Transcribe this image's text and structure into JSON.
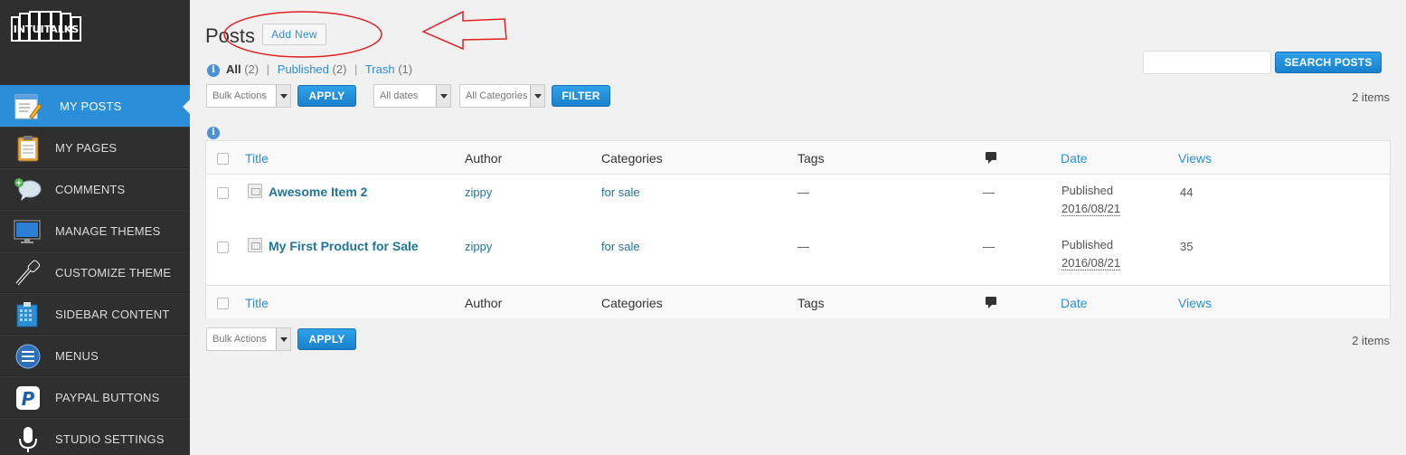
{
  "sidebar": {
    "logo_text": "INTUITALKS",
    "items": [
      {
        "label": "MY POSTS",
        "icon": "posts-icon",
        "active": true
      },
      {
        "label": "MY PAGES",
        "icon": "pages-icon"
      },
      {
        "label": "COMMENTS",
        "icon": "comments-icon"
      },
      {
        "label": "MANAGE THEMES",
        "icon": "monitor-icon"
      },
      {
        "label": "CUSTOMIZE THEME",
        "icon": "eyedropper-icon"
      },
      {
        "label": "SIDEBAR CONTENT",
        "icon": "sidebar-icon"
      },
      {
        "label": "MENUS",
        "icon": "menu-icon"
      },
      {
        "label": "PAYPAL BUTTONS",
        "icon": "paypal-icon"
      },
      {
        "label": "STUDIO SETTINGS",
        "icon": "microphone-icon"
      }
    ]
  },
  "header": {
    "title": "Posts",
    "add_new": "Add New"
  },
  "filters": {
    "all_label": "All",
    "all_count": "(2)",
    "published_label": "Published",
    "published_count": "(2)",
    "trash_label": "Trash",
    "trash_count": "(1)",
    "separator": "|"
  },
  "toolbar": {
    "bulk_actions": "Bulk Actions",
    "apply": "APPLY",
    "all_dates": "All dates",
    "all_categories": "All Categories",
    "filter": "FILTER",
    "search_button": "SEARCH POSTS",
    "search_value": "",
    "items_count": "2 items"
  },
  "table": {
    "columns": {
      "title": "Title",
      "author": "Author",
      "categories": "Categories",
      "tags": "Tags",
      "date": "Date",
      "views": "Views"
    },
    "rows": [
      {
        "title": "Awesome Item 2",
        "author": "zippy",
        "category": "for sale",
        "tags": "—",
        "comments": "—",
        "status": "Published",
        "date": "2016/08/21",
        "views": "44"
      },
      {
        "title": "My First Product for Sale",
        "author": "zippy",
        "category": "for sale",
        "tags": "—",
        "comments": "—",
        "status": "Published",
        "date": "2016/08/21",
        "views": "35"
      }
    ]
  },
  "colors": {
    "accent": "#2a8fd8",
    "sidebar_bg": "#2f2f2f",
    "annotation": "#e02020"
  }
}
